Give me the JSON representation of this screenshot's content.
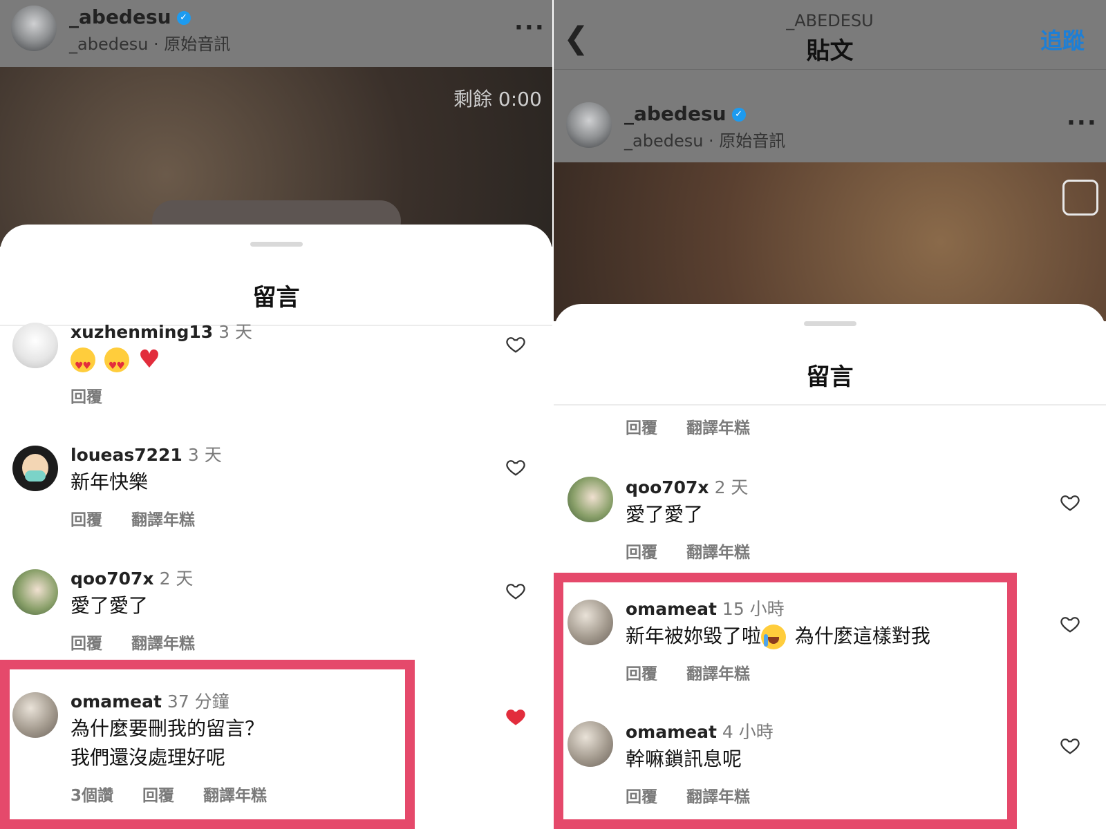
{
  "left": {
    "author": {
      "username": "_abedesu",
      "subtitle": "_abedesu · 原始音訊"
    },
    "video": {
      "remaining": "剩餘 0:00"
    },
    "sheet_title": "留言",
    "comments": [
      {
        "user": "xuzhenming13",
        "time": "3 天",
        "text_emoji": [
          "heart-eyes-emoji",
          "heart-eyes-emoji",
          "red-heart-emoji"
        ],
        "actions": [
          "回覆"
        ]
      },
      {
        "user": "loueas7221",
        "time": "3 天",
        "text": "新年快樂",
        "actions": [
          "回覆",
          "翻譯年糕"
        ]
      },
      {
        "user": "qoo707x",
        "time": "2 天",
        "text": "愛了愛了",
        "actions": [
          "回覆",
          "翻譯年糕"
        ]
      },
      {
        "user": "omameat",
        "time": "37 分鐘",
        "text_line1": "為什麼要刪我的留言？",
        "text_line2": "我們還沒處理好呢",
        "likes": "3個讚",
        "actions": [
          "回覆",
          "翻譯年糕"
        ],
        "liked": true
      }
    ]
  },
  "right": {
    "header": {
      "account": "_ABEDESU",
      "title": "貼文",
      "follow": "追蹤"
    },
    "author": {
      "username": "_abedesu",
      "subtitle": "_abedesu · 原始音訊"
    },
    "sheet_title": "留言",
    "top_actions": [
      "回覆",
      "翻譯年糕"
    ],
    "comments": [
      {
        "user": "qoo707x",
        "time": "2 天",
        "text": "愛了愛了",
        "actions": [
          "回覆",
          "翻譯年糕"
        ]
      },
      {
        "user": "omameat",
        "time": "15 小時",
        "text_a": "新年被妳毀了啦",
        "text_b": "為什麼這樣對我",
        "actions": [
          "回覆",
          "翻譯年糕"
        ]
      },
      {
        "user": "omameat",
        "time": "4 小時",
        "text": "幹嘛鎖訊息呢",
        "actions": [
          "回覆",
          "翻譯年糕"
        ]
      }
    ]
  },
  "colors": {
    "highlight": "#e5496b",
    "liked_heart": "#e22d3c",
    "follow": "#1d9bf0"
  }
}
